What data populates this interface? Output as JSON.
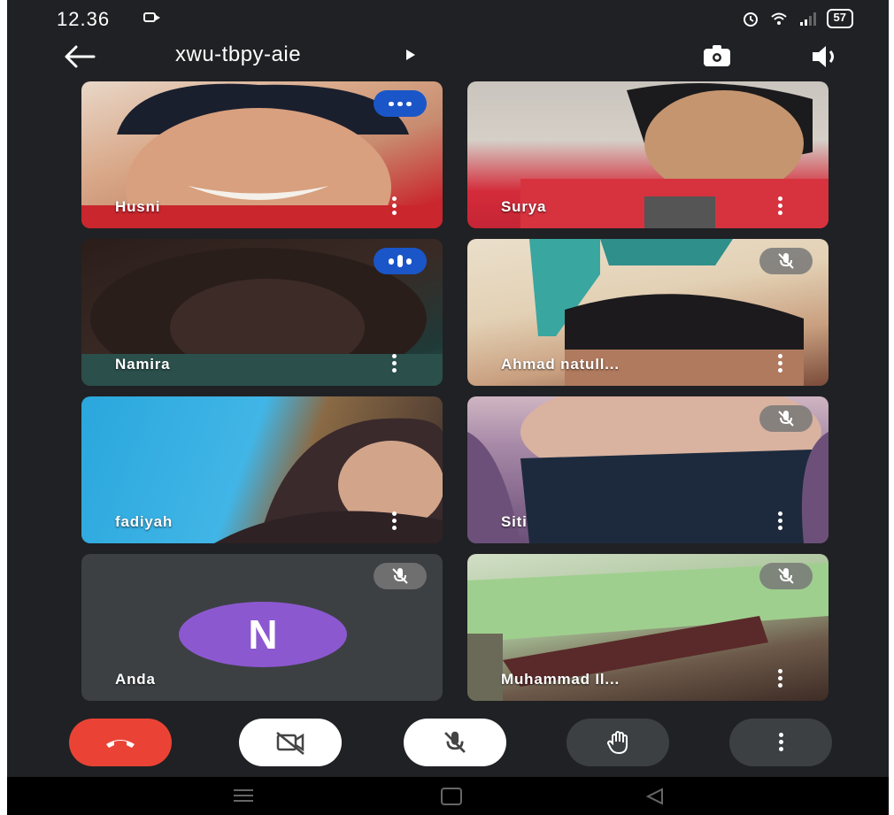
{
  "status_bar": {
    "time": "12.36",
    "battery": "57",
    "icons": [
      "video-camera-icon",
      "alarm-icon",
      "wifi-icon",
      "signal-icon",
      "battery-icon"
    ]
  },
  "meeting": {
    "code": "xwu-tbpy-aie",
    "icons": [
      "back-arrow-icon",
      "expand-arrow-icon",
      "switch-camera-icon",
      "speaker-icon"
    ]
  },
  "participants": [
    {
      "name": "Husni",
      "status": "speaking",
      "video": true
    },
    {
      "name": "Surya",
      "status": "none",
      "video": true
    },
    {
      "name": "Namira",
      "status": "speaking",
      "video": true
    },
    {
      "name": "Ahmad natull...",
      "status": "muted",
      "video": true
    },
    {
      "name": "fadiyah",
      "status": "none",
      "video": true
    },
    {
      "name": "Siti",
      "status": "muted",
      "video": true
    },
    {
      "name": "Anda",
      "status": "muted",
      "video": false,
      "avatar_letter": "N",
      "avatar_color": "#8c58d0"
    },
    {
      "name": "Muhammad Il...",
      "status": "muted",
      "video": true
    }
  ],
  "controls": [
    "end-call-button",
    "camera-off-button",
    "mic-off-button",
    "raise-hand-button",
    "more-options-button"
  ],
  "colors": {
    "background": "#202124",
    "speaking_badge": "#1a56c8",
    "end_call": "#ea4335",
    "avatar": "#8c58d0"
  }
}
